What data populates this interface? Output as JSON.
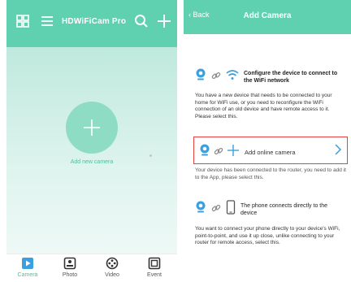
{
  "left_screen": {
    "app_title": "HDWiFiCam Pro",
    "add_label": "Add new camera",
    "nav": [
      {
        "label": "Camera",
        "icon": "camera-play-icon",
        "active": true
      },
      {
        "label": "Photo",
        "icon": "photo-icon",
        "active": false
      },
      {
        "label": "Video",
        "icon": "video-reel-icon",
        "active": false
      },
      {
        "label": "Event",
        "icon": "event-icon",
        "active": false
      }
    ]
  },
  "right_screen": {
    "back_label": "Back",
    "title": "Add Camera",
    "options": {
      "wifi": {
        "title": "Configure the device to connect to the WiFi network",
        "description": "You have a new device that needs to be connected to your home for WiFi use, or you need to reconfigure the WiFi connection of an old device and have remote access to it. Please select this."
      },
      "online": {
        "title": "Add online camera",
        "description": "Your device has been connected to the router, you need to add it to the App, please select this."
      },
      "direct": {
        "title": "The phone connects directly to the device",
        "description": "You want to connect your phone directly to your device's WiFi, point-to-point, and use it up close, unlike connecting to your router for remote access, select this."
      }
    }
  },
  "colors": {
    "accent": "#5fd0b0",
    "highlight": "#e84141",
    "icon_blue": "#3aa0e0"
  }
}
